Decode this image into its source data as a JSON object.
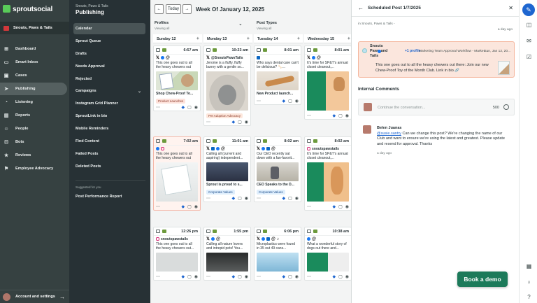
{
  "app": {
    "brand": "sproutsocial"
  },
  "nav": {
    "account": "Snouts, Paws & Tails",
    "items": [
      {
        "label": "Dashboard",
        "icon": "dashboard-icon",
        "glyph": "⊞"
      },
      {
        "label": "Smart Inbox",
        "icon": "inbox-icon",
        "glyph": "▭"
      },
      {
        "label": "Cases",
        "icon": "cases-icon",
        "glyph": "▣"
      },
      {
        "label": "Publishing",
        "icon": "publishing-icon",
        "glyph": "➤"
      },
      {
        "label": "Listening",
        "icon": "listening-icon",
        "glyph": "◔"
      },
      {
        "label": "Reports",
        "icon": "reports-icon",
        "glyph": "▥"
      },
      {
        "label": "People",
        "icon": "people-icon",
        "glyph": "☺"
      },
      {
        "label": "Bots",
        "icon": "bots-icon",
        "glyph": "⊡"
      },
      {
        "label": "Reviews",
        "icon": "reviews-icon",
        "glyph": "★"
      },
      {
        "label": "Employee Advocacy",
        "icon": "advocacy-icon",
        "glyph": "⚑"
      }
    ],
    "footer": "Account and settings"
  },
  "nav2": {
    "account": "Snouts, Paws & Tails",
    "title": "Publishing",
    "items": [
      "Calendar",
      "Sprout Queue",
      "Drafts",
      "Needs Approval",
      "Rejected",
      "Campaigns",
      "Instagram Grid Planner",
      "SproutLink in bio",
      "Mobile Reminders",
      "Find Content",
      "Failed Posts",
      "Deleted Posts"
    ],
    "suggested_label": "Suggested for you",
    "suggested": "Post Performance Report"
  },
  "calendar": {
    "today": "Today",
    "prev": "←",
    "next": "→",
    "week": "Week Of January 12, 2025",
    "filters": [
      {
        "label": "Profiles",
        "sub": "Viewing all"
      },
      {
        "label": "Post Types",
        "sub": "Viewing all"
      }
    ],
    "days": [
      {
        "name": "Sunday 12",
        "cards": [
          {
            "time": "6:57 am",
            "nets": [
              "x",
              "fb",
              "th"
            ],
            "text": "This one goes out to all the heavy chewers out there...",
            "img": "i-chew",
            "cap": "Shop Chew-Proof To...",
            "tag": "Product Launches",
            "tagc": "pl"
          },
          {
            "time": "7:02 am",
            "nets": [
              "fb",
              "ig"
            ],
            "text": "This one goes out to all the heavy chewers out there...",
            "img": "i-pkg tall",
            "cap": "",
            "tag": "",
            "sel": true
          },
          {
            "time": "12:26 pm",
            "nets": [],
            "handle": "snoutspawstails",
            "text": "This one goes out to all the heavy chewers out...",
            "img": "i-grey",
            "cap": "",
            "tag": ""
          }
        ]
      },
      {
        "name": "Monday 13",
        "cards": [
          {
            "time": "10:23 am",
            "nets": [],
            "handle": "@SnoutsPawsTails",
            "htype": "x",
            "text": "Jerome is a fluffy, fluffy bunny with a gentle so...",
            "img": "i-rabbit tall",
            "cap": "",
            "tag": "Pet Adoption Advocacy",
            "tagc": "pa"
          },
          {
            "time": "11:01 am",
            "nets": [
              "x",
              "li",
              "fb",
              "th"
            ],
            "text": "Calling all (current and aspiring) independent...",
            "img": "i-crowd",
            "cap": "Sprout is proud to s...",
            "tag": "Corporate Values",
            "tagc": "cv"
          },
          {
            "time": "1:55 pm",
            "nets": [
              "x",
              "fb",
              "th"
            ],
            "text": "Calling all nature lovers and intrepid pets! You...",
            "img": "i-dark",
            "cap": "",
            "tag": ""
          }
        ]
      },
      {
        "name": "Tuesday 14",
        "cards": [
          {
            "time": "8:01 am",
            "nets": [
              "li"
            ],
            "text": "Who says dental care can't be delicious? 🦴...",
            "img": "i-bone",
            "cap": "New Product launch...",
            "tag": ""
          },
          {
            "time": "8:02 am",
            "nets": [
              "x",
              "fb",
              "li",
              "th"
            ],
            "text": "Our CEO recently sat down with a fan-favorit...",
            "img": "i-stage",
            "cap": "CEO Speaks to the D...",
            "tag": "Corporate Values",
            "tagc": "cv"
          },
          {
            "time": "6:06 pm",
            "nets": [
              "x",
              "fb",
              "li",
              "th",
              "tk"
            ],
            "text": "Microplastics were found in 35 out 49 cans...",
            "img": "i-water",
            "cap": "",
            "tag": ""
          }
        ]
      },
      {
        "name": "Wednesday 15",
        "cards": [
          {
            "time": "8:01 am",
            "nets": [
              "x",
              "fb",
              "th"
            ],
            "text": "It's time for SP&T's annual closet cleanout,...",
            "img": "i-sp tall",
            "cap": "",
            "tag": ""
          },
          {
            "time": "8:02 am",
            "nets": [],
            "handle": "snoutspawstails",
            "text": "It's time for SP&T's annual closet cleanout,...",
            "img": "i-dogs tall",
            "cap": "",
            "tag": ""
          },
          {
            "time": "10:38 am",
            "nets": [
              "fb",
              "th"
            ],
            "text": "What a wonderful story of dogs out there and...",
            "img": "i-sp2",
            "cap": "",
            "tag": ""
          }
        ]
      }
    ]
  },
  "panel": {
    "title": "Scheduled Post 1/7/2025",
    "account": "in Snouts, Paws & Tails -",
    "ago": "a day ago",
    "post": {
      "profile": "Snouts Paws and Tails",
      "more_profiles": "+1 profile",
      "workflow": "Marketing Team Approval Workflow - Market...",
      "date": "Sun, Jan 12, 20...",
      "text": "This one goes out to all the heavy chewers out there: Join our new Chew-Proof Toy of the Month Club. Link in bio 🔗"
    },
    "comments_title": "Internal Comments",
    "comment_placeholder": "Continue the conversation...",
    "char_count": "500",
    "comment": {
      "author": "Belen Juanas",
      "mention": "@susie.santry",
      "text": " Can we change this post? We're changing the name of our Club and want to ensure we're using the latest and greatest. Please update and resend for approval.  Thanks",
      "ago": "a day ago"
    }
  },
  "cta": "Book a demo",
  "colors": {
    "brand": "#59cb59",
    "accent": "#1e66d0",
    "cta": "#1c7a5a",
    "nav": "#364141"
  }
}
